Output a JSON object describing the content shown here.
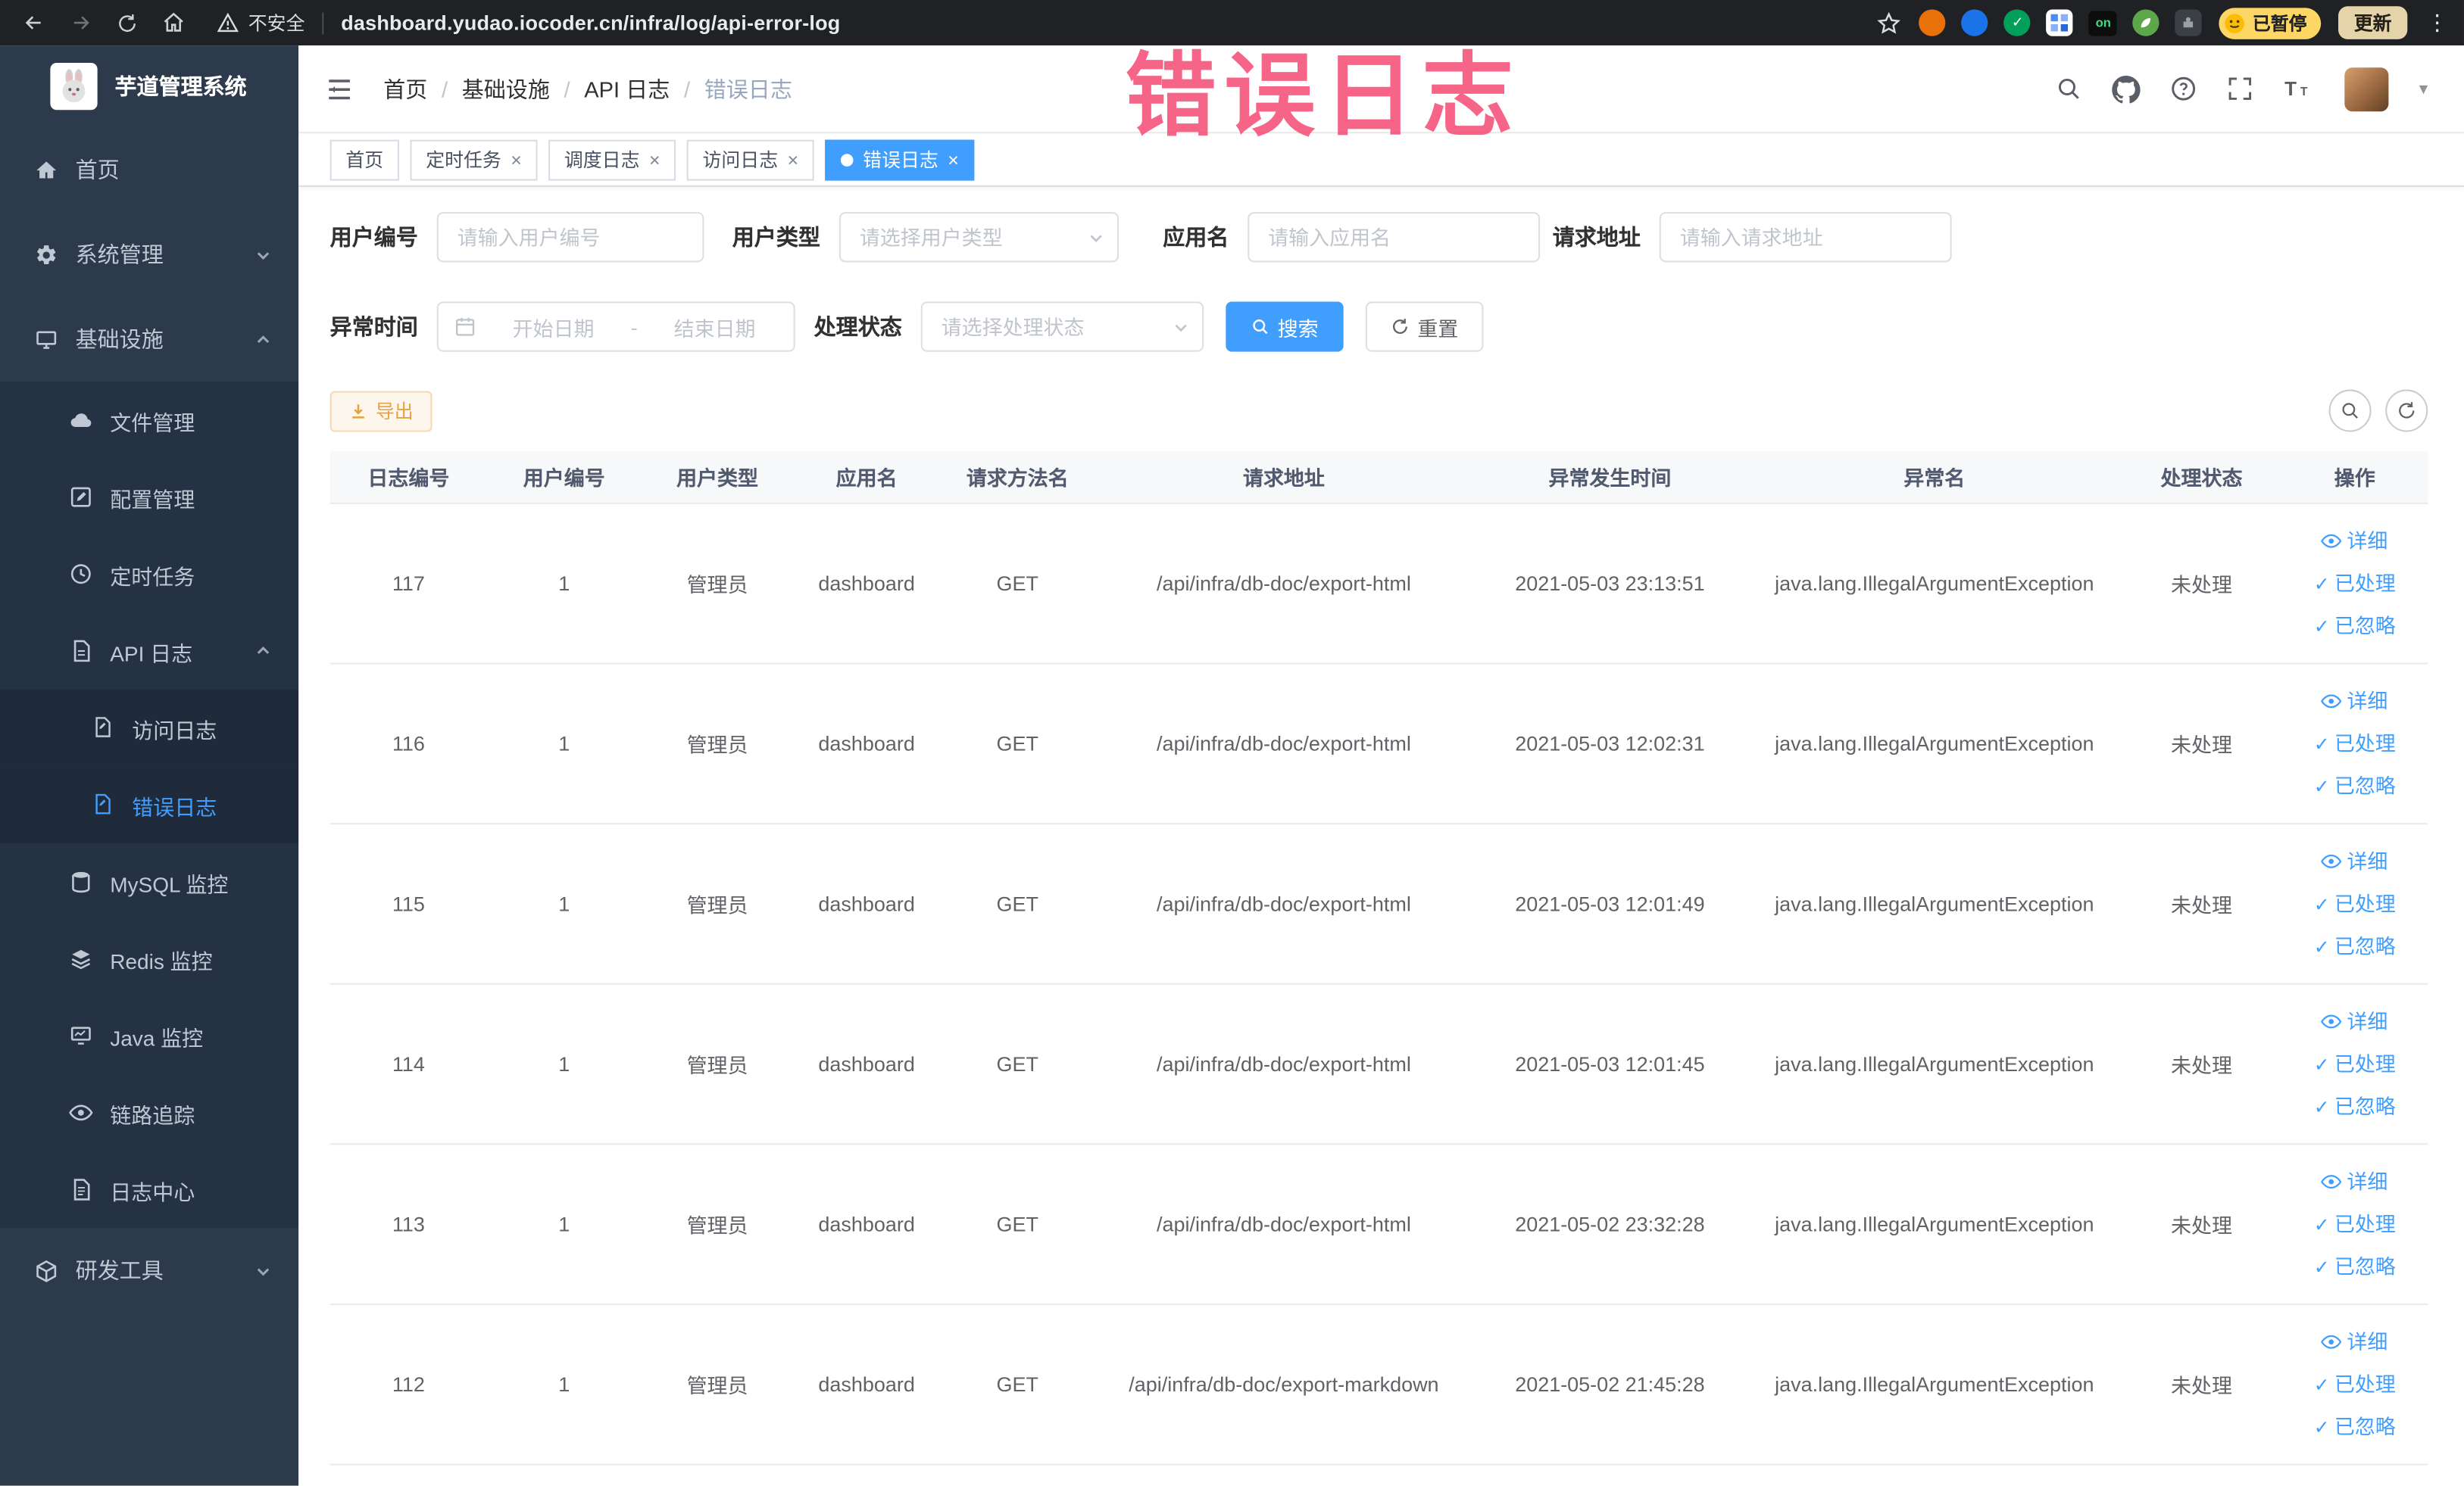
{
  "icons": {
    "check": "✓",
    "close": "×",
    "kebab": "⋮",
    "caret": "▾",
    "question": "?",
    "on_badge": "on"
  },
  "browser": {
    "security": "不安全",
    "url": "dashboard.yudao.iocoder.cn/infra/log/api-error-log",
    "paused": "已暂停",
    "update": "更新"
  },
  "annotation": "错误日志",
  "sidebar": {
    "title": "芋道管理系统",
    "items": [
      {
        "label": "首页",
        "icon": "home-icon"
      },
      {
        "label": "系统管理",
        "icon": "gear-icon"
      },
      {
        "label": "基础设施",
        "icon": "monitor-icon"
      },
      {
        "label": "文件管理",
        "icon": "cloud-icon"
      },
      {
        "label": "配置管理",
        "icon": "edit-icon"
      },
      {
        "label": "定时任务",
        "icon": "clock-icon"
      },
      {
        "label": "API 日志",
        "icon": "document-icon"
      },
      {
        "label": "访问日志",
        "icon": "document-icon"
      },
      {
        "label": "错误日志",
        "icon": "document-icon"
      },
      {
        "label": "MySQL 监控",
        "icon": "database-icon"
      },
      {
        "label": "Redis 监控",
        "icon": "layers-icon"
      },
      {
        "label": "Java 监控",
        "icon": "screen-icon"
      },
      {
        "label": "链路追踪",
        "icon": "eye-icon"
      },
      {
        "label": "日志中心",
        "icon": "document-icon"
      },
      {
        "label": "研发工具",
        "icon": "box-icon"
      }
    ]
  },
  "breadcrumb": {
    "separator": "/",
    "items": [
      "首页",
      "基础设施",
      "API 日志",
      "错误日志"
    ]
  },
  "tabs": [
    {
      "label": "首页"
    },
    {
      "label": "定时任务"
    },
    {
      "label": "调度日志"
    },
    {
      "label": "访问日志"
    },
    {
      "label": "错误日志"
    }
  ],
  "filters": {
    "user_id": {
      "label": "用户编号",
      "placeholder": "请输入用户编号"
    },
    "user_type": {
      "label": "用户类型",
      "placeholder": "请选择用户类型"
    },
    "app_name": {
      "label": "应用名",
      "placeholder": "请输入应用名"
    },
    "request_url": {
      "label": "请求地址",
      "placeholder": "请输入请求地址"
    },
    "exception_time": {
      "label": "异常时间",
      "start_placeholder": "开始日期",
      "separator": "-",
      "end_placeholder": "结束日期"
    },
    "process_status": {
      "label": "处理状态",
      "placeholder": "请选择处理状态"
    },
    "search": "搜索",
    "reset": "重置"
  },
  "toolbar": {
    "export": "导出"
  },
  "table": {
    "columns": [
      "日志编号",
      "用户编号",
      "用户类型",
      "应用名",
      "请求方法名",
      "请求地址",
      "异常发生时间",
      "异常名",
      "处理状态",
      "操作"
    ],
    "actions": {
      "detail": "详细",
      "processed": "已处理",
      "ignored": "已忽略"
    },
    "rows": [
      {
        "id": "117",
        "user_id": "1",
        "user_type": "管理员",
        "app": "dashboard",
        "method": "GET",
        "url": "/api/infra/db-doc/export-html",
        "time": "2021-05-03 23:13:51",
        "exception": "java.lang.IllegalArgumentException",
        "status": "未处理"
      },
      {
        "id": "116",
        "user_id": "1",
        "user_type": "管理员",
        "app": "dashboard",
        "method": "GET",
        "url": "/api/infra/db-doc/export-html",
        "time": "2021-05-03 12:02:31",
        "exception": "java.lang.IllegalArgumentException",
        "status": "未处理"
      },
      {
        "id": "115",
        "user_id": "1",
        "user_type": "管理员",
        "app": "dashboard",
        "method": "GET",
        "url": "/api/infra/db-doc/export-html",
        "time": "2021-05-03 12:01:49",
        "exception": "java.lang.IllegalArgumentException",
        "status": "未处理"
      },
      {
        "id": "114",
        "user_id": "1",
        "user_type": "管理员",
        "app": "dashboard",
        "method": "GET",
        "url": "/api/infra/db-doc/export-html",
        "time": "2021-05-03 12:01:45",
        "exception": "java.lang.IllegalArgumentException",
        "status": "未处理"
      },
      {
        "id": "113",
        "user_id": "1",
        "user_type": "管理员",
        "app": "dashboard",
        "method": "GET",
        "url": "/api/infra/db-doc/export-html",
        "time": "2021-05-02 23:32:28",
        "exception": "java.lang.IllegalArgumentException",
        "status": "未处理"
      },
      {
        "id": "112",
        "user_id": "1",
        "user_type": "管理员",
        "app": "dashboard",
        "method": "GET",
        "url": "/api/infra/db-doc/export-markdown",
        "time": "2021-05-02 21:45:28",
        "exception": "java.lang.IllegalArgumentException",
        "status": "未处理"
      }
    ]
  },
  "colors": {
    "accent": "#409eff",
    "warning": "#e6a23c",
    "annotation_pink": "#f43f69",
    "sidebar_bg": "#2d3a4b"
  }
}
